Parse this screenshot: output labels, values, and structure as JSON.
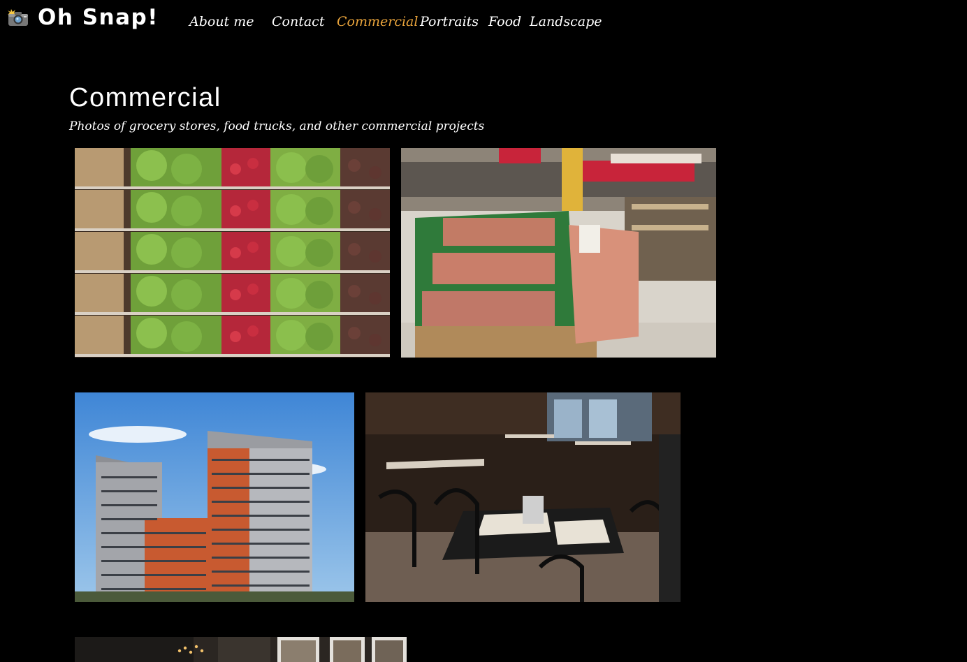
{
  "site": {
    "brand": "Oh Snap!",
    "logo_icon": "camera-flash-icon"
  },
  "nav": {
    "items": [
      {
        "label": "About me"
      },
      {
        "label": "Contact"
      },
      {
        "label": "Commercial"
      },
      {
        "label": "Portraits"
      },
      {
        "label": "Food"
      },
      {
        "label": "Landscape"
      }
    ],
    "active": "Commercial",
    "active_color": "#e8a33b"
  },
  "page": {
    "title": "Commercial",
    "subtitle": "Photos of grocery stores, food trucks, and other commercial projects"
  },
  "gallery": [
    {
      "subject": "produce-shelves-photo"
    },
    {
      "subject": "supermarket-fruit-display-photo"
    },
    {
      "subject": "apartment-tower-photo"
    },
    {
      "subject": "restaurant-dining-room-photo"
    },
    {
      "subject": "cafe-interior-photo"
    }
  ]
}
